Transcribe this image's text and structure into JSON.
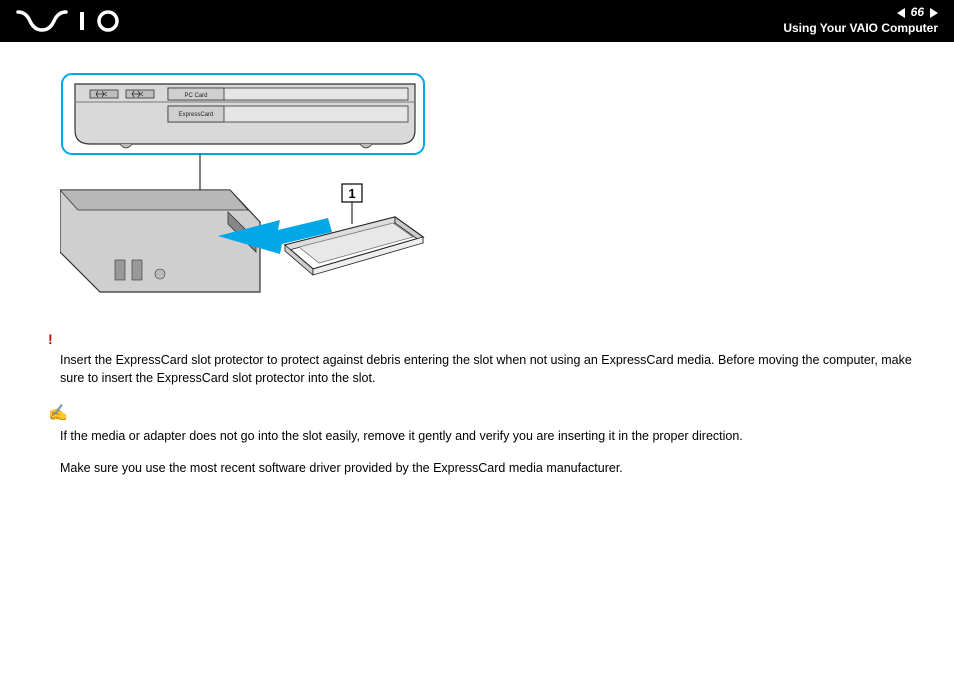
{
  "header": {
    "page_number": "66",
    "section_title": "Using Your VAIO Computer"
  },
  "diagram": {
    "label_pc_card": "PC Card",
    "label_expresscard": "ExpressCard",
    "callout_1": "1"
  },
  "warning": {
    "text": "Insert the ExpressCard slot protector to protect against debris entering the slot when not using an ExpressCard media. Before moving the computer, make sure to insert the ExpressCard slot protector into the slot."
  },
  "note": {
    "text1": "If the media or adapter does not go into the slot easily, remove it gently and verify you are inserting it in the proper direction.",
    "text2": "Make sure you use the most recent software driver provided by the ExpressCard media manufacturer."
  }
}
